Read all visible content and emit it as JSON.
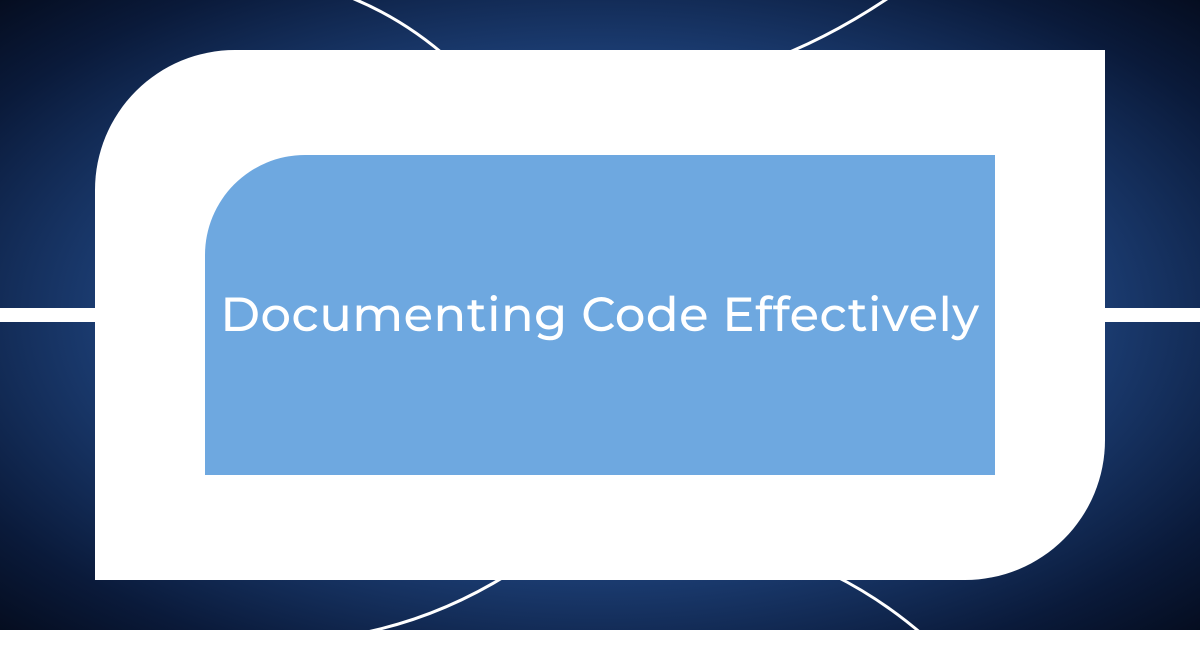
{
  "title": "Documenting Code Effectively",
  "colors": {
    "inner_panel": "#6ea8e0",
    "frame": "#ffffff",
    "bg_center": "#4a7db8",
    "bg_edge": "#050d20"
  }
}
